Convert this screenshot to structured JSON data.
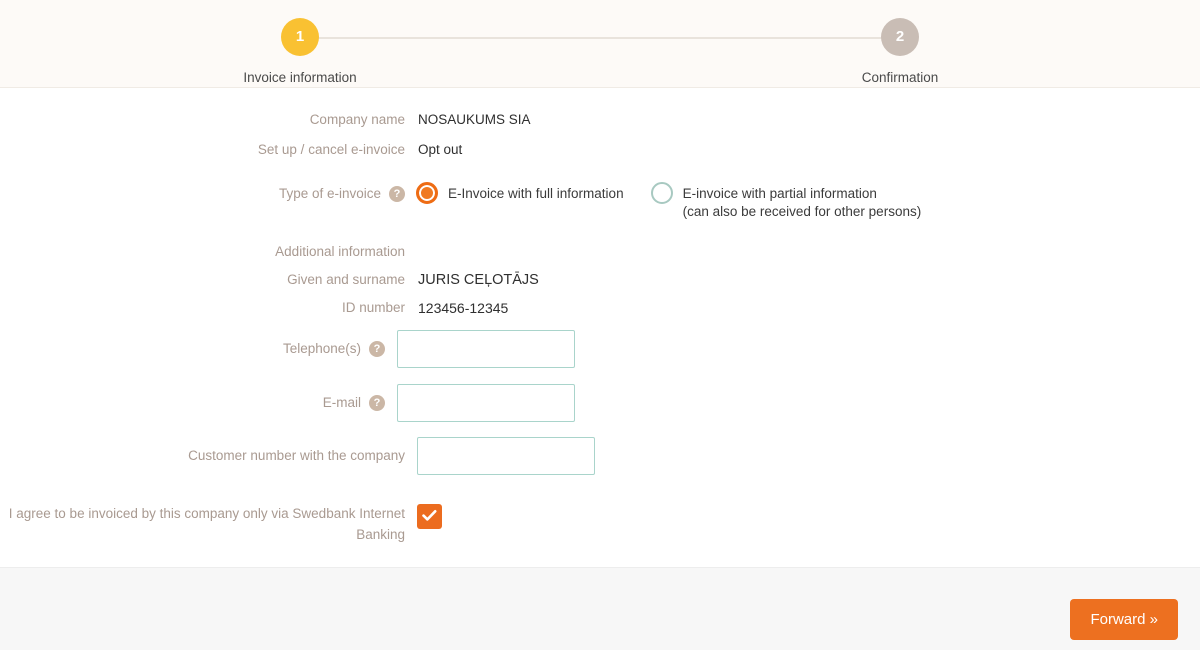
{
  "stepper": {
    "steps": [
      {
        "number": "1",
        "label": "Invoice information",
        "state": "active"
      },
      {
        "number": "2",
        "label": "Confirmation",
        "state": "inactive"
      }
    ]
  },
  "form": {
    "company_name_label": "Company name",
    "company_name_value": "NOSAUKUMS  SIA",
    "setup_cancel_label": "Set up / cancel e-invoice",
    "setup_cancel_value": "Opt out",
    "type_label": "Type of e-invoice",
    "type_help_icon": "question-mark-icon",
    "type_options": [
      {
        "label": "E-Invoice with full information",
        "sub": "",
        "selected": true
      },
      {
        "label": "E-invoice with partial information",
        "sub": "(can also be received for other persons)",
        "selected": false
      }
    ],
    "additional_info_label": "Additional information",
    "given_surname_label": "Given and surname",
    "given_surname_value": "JURIS CEĻOTĀJS",
    "id_number_label": "ID number",
    "id_number_value": "123456-12345",
    "telephone_label": "Telephone(s)",
    "telephone_value": "",
    "telephone_help_icon": "question-mark-icon",
    "email_label": "E-mail",
    "email_value": "",
    "email_help_icon": "question-mark-icon",
    "customer_number_label": "Customer number with the company",
    "customer_number_value": "",
    "agree_label": "I agree to be invoiced by this company only via Swedbank Internet Banking",
    "agree_checked": true,
    "check_icon": "checkmark-icon"
  },
  "footer": {
    "forward_label": "Forward »"
  },
  "colors": {
    "accent_orange": "#ed7020",
    "step_active": "#f9c132",
    "step_inactive": "#c9bdb5",
    "input_border": "#a9d4cb",
    "label_text": "#a99a91",
    "header_band": "#fdfaf7",
    "footer_band": "#f7f7f7"
  }
}
